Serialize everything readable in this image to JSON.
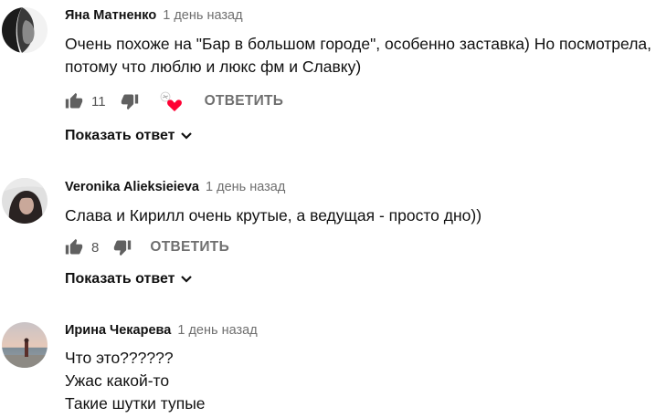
{
  "comments": [
    {
      "author": "Яна Матненко",
      "time": "1 день назад",
      "lines": [
        "Очень похоже на \"Бар в большом городе\", особенно заставка) Но посмотрела,",
        "потому что люблю и люкс фм и Славку)"
      ],
      "likes": "11",
      "reply_label": "ОТВЕТИТЬ",
      "show_reply_label": "Показать ответ",
      "heart_color": "#ff0033"
    },
    {
      "author": "Veronika Alieksieieva",
      "time": "1 день назад",
      "lines": [
        "Слава и Кирилл очень крутые, а ведущая - просто дно))"
      ],
      "likes": "8",
      "reply_label": "ОТВЕТИТЬ",
      "show_reply_label": "Показать ответ"
    },
    {
      "author": "Ирина Чекарева",
      "time": "1 день назад",
      "lines": [
        "Что это??????",
        "Ужас какой-то",
        "Такие шутки тупые"
      ]
    }
  ]
}
